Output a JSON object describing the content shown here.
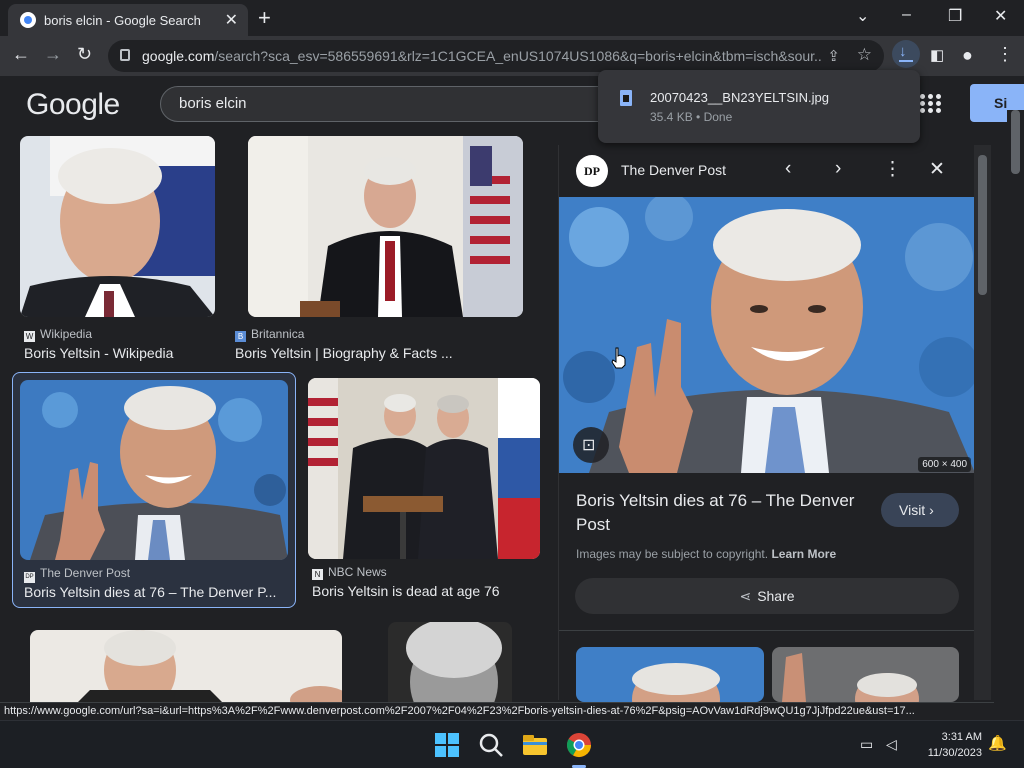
{
  "browser": {
    "tab_title": "boris elcin - Google Search",
    "url_host": "google.com",
    "url_rest": "/search?sca_esv=586559691&rlz=1C1GCEA_enUS1074US1086&q=boris+elcin&tbm=isch&sour..."
  },
  "download": {
    "filename": "20070423__BN23YELTSIN.jpg",
    "meta": "35.4 KB • Done"
  },
  "google": {
    "logo": "Google",
    "query": "boris elcin",
    "signin_label": "Si"
  },
  "results": [
    {
      "source": "Wikipedia",
      "source_icon": "W",
      "title": "Boris Yeltsin - Wikipedia"
    },
    {
      "source": "Britannica",
      "source_icon": "B",
      "title": "Boris Yeltsin | Biography & Facts ..."
    },
    {
      "source": "The Denver Post",
      "source_icon": "DP",
      "title": "Boris Yeltsin dies at 76 – The Denver P..."
    },
    {
      "source": "NBC News",
      "source_icon": "N",
      "title": "Boris Yeltsin is dead at age 76"
    }
  ],
  "panel": {
    "logo": "DP",
    "source": "The Denver Post",
    "dimensions": "600 × 400",
    "title": "Boris Yeltsin dies at 76 – The Denver Post",
    "visit_label": "Visit",
    "copyright_text": "Images may be subject to copyright.",
    "learn_more": "Learn More",
    "share_label": "Share"
  },
  "status_url": "https://www.google.com/url?sa=i&url=https%3A%2F%2Fwww.denverpost.com%2F2007%2F04%2F23%2Fboris-yeltsin-dies-at-76%2F&psig=AOvVaw1dRdj9wQU1g7JjJfpd22ue&ust=17...",
  "taskbar": {
    "time": "3:31 AM",
    "date": "11/30/2023"
  }
}
